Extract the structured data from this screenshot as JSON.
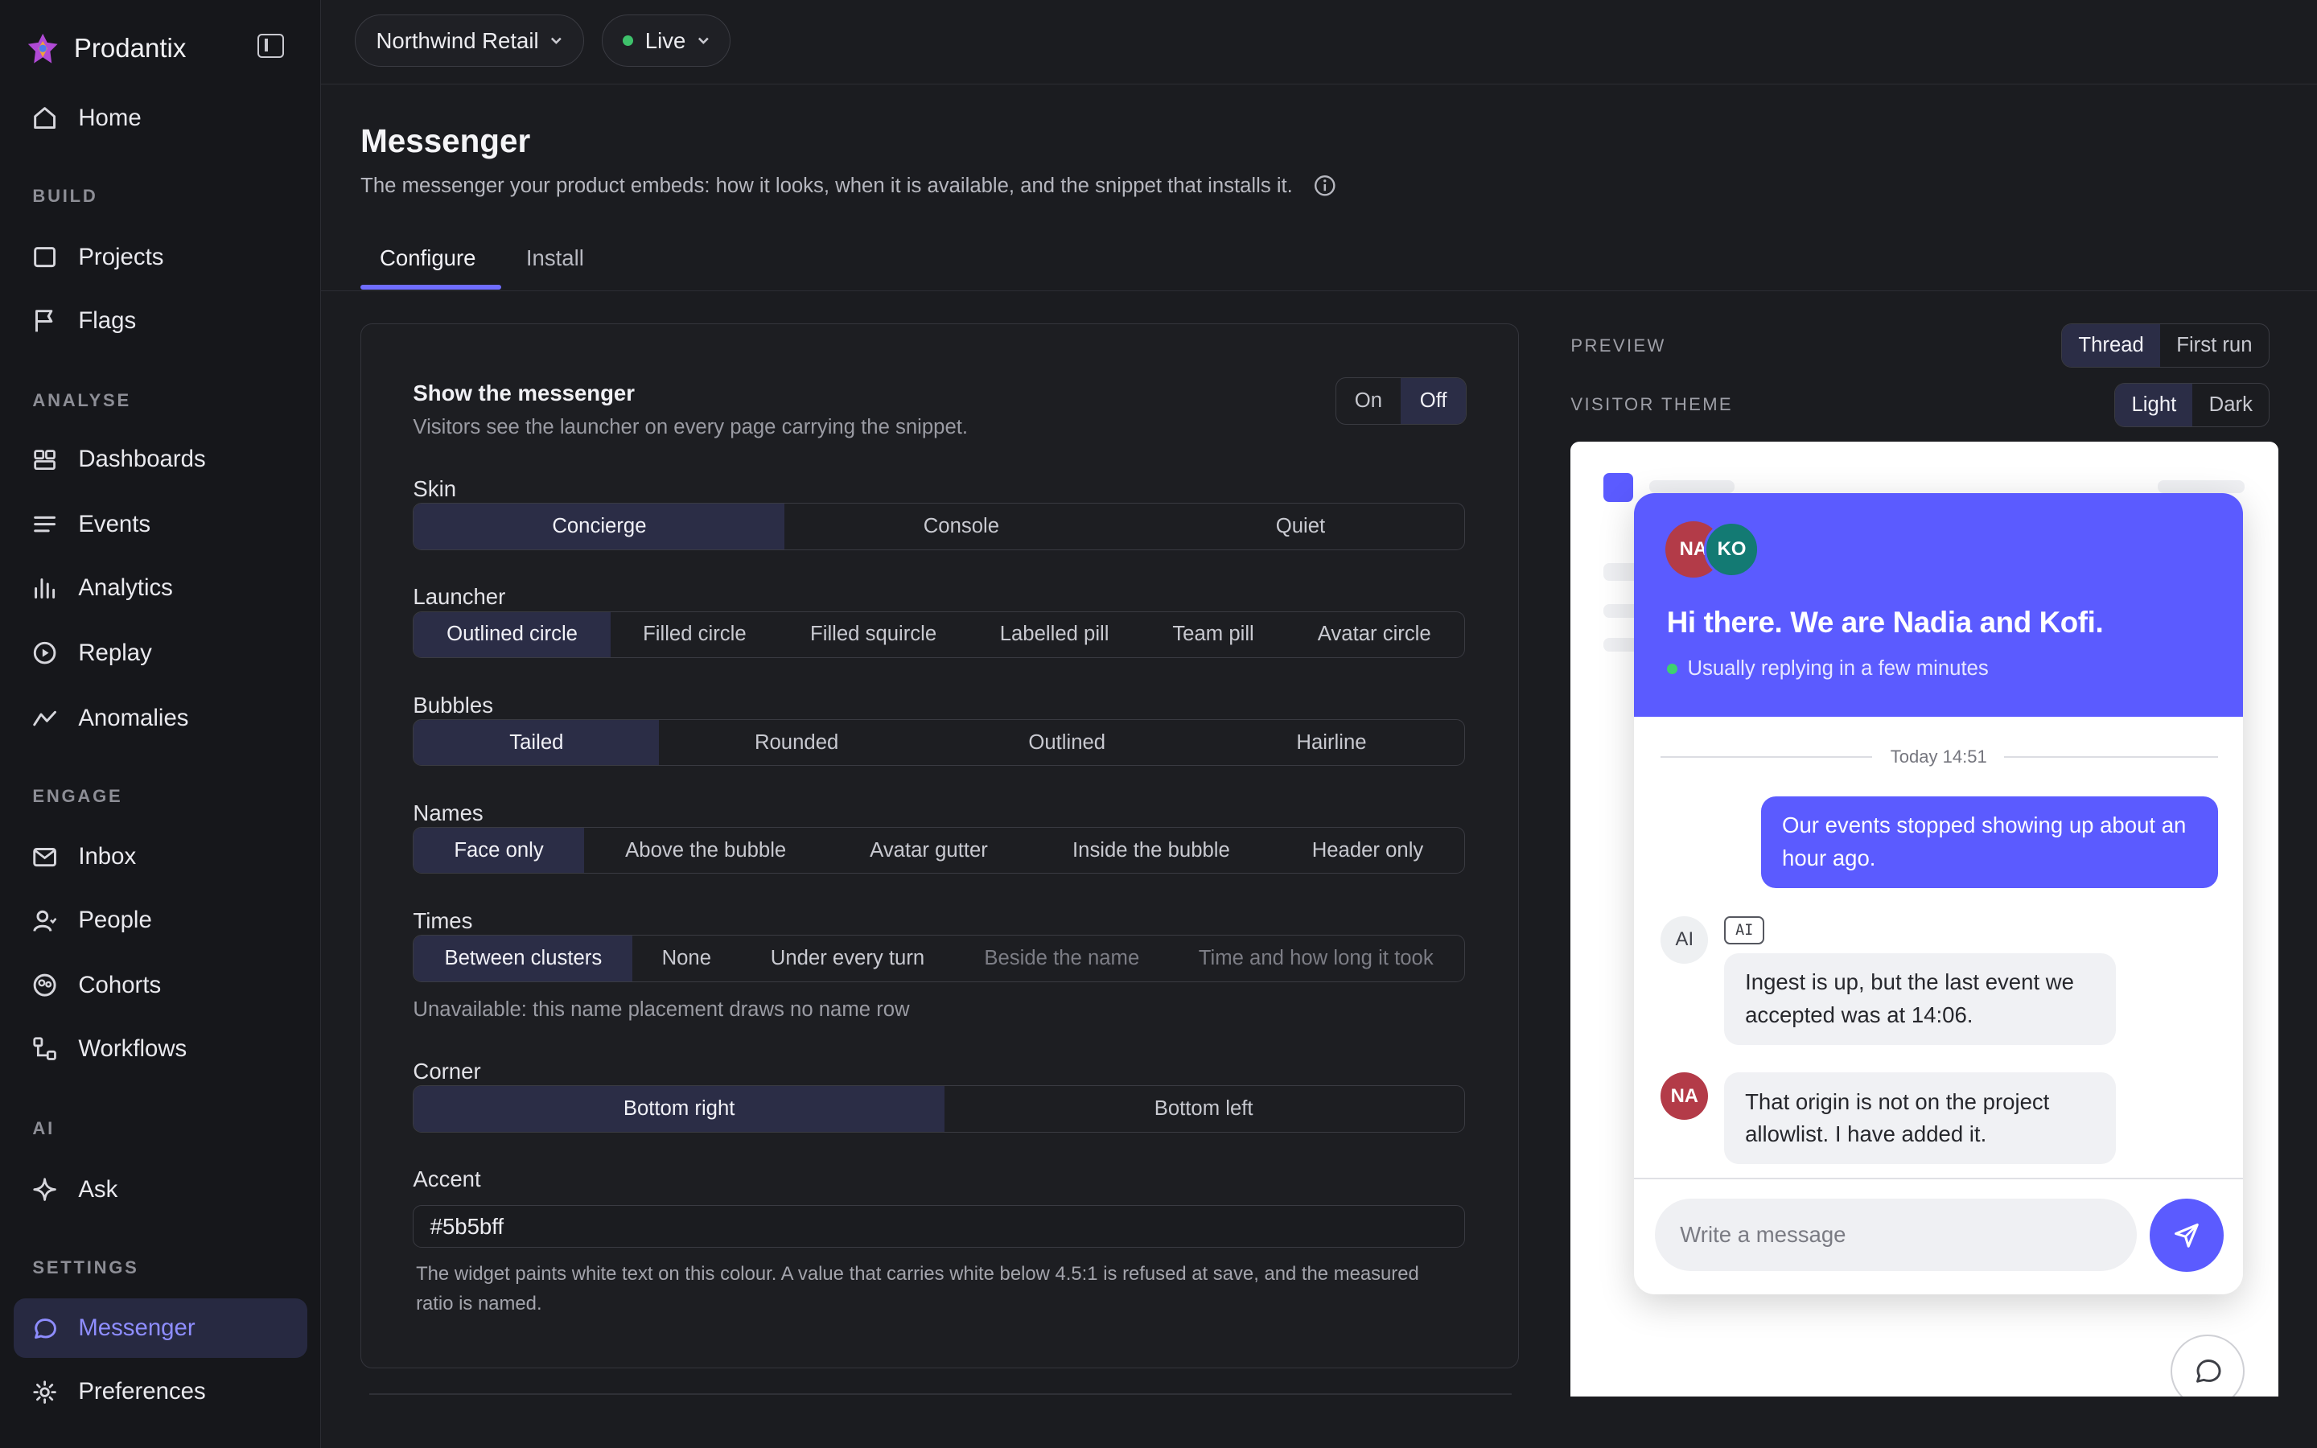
{
  "app": {
    "name": "Prodantix"
  },
  "sidebar": {
    "home": "Home",
    "sections": {
      "build": "BUILD",
      "analyse": "ANALYSE",
      "engage": "ENGAGE",
      "ai": "AI",
      "settings": "SETTINGS"
    },
    "items": {
      "projects": "Projects",
      "flags": "Flags",
      "dashboards": "Dashboards",
      "events": "Events",
      "analytics": "Analytics",
      "replay": "Replay",
      "anomalies": "Anomalies",
      "inbox": "Inbox",
      "people": "People",
      "cohorts": "Cohorts",
      "workflows": "Workflows",
      "ask": "Ask",
      "messenger": "Messenger",
      "preferences": "Preferences"
    },
    "active": "messenger"
  },
  "topbar": {
    "workspace": "Northwind Retail",
    "environment": "Live",
    "environment_status_color": "#3ec16b"
  },
  "page": {
    "title": "Messenger",
    "subtitle": "The messenger your product embeds: how it looks, when it is available, and the snippet that installs it.",
    "tabs": {
      "configure": "Configure",
      "install": "Install"
    },
    "active_tab": "Configure"
  },
  "config": {
    "show": {
      "label": "Show the messenger",
      "help": "Visitors see the launcher on every page carrying the snippet.",
      "on": "On",
      "off": "Off",
      "selected": "Off"
    },
    "skin": {
      "label": "Skin",
      "options": [
        "Concierge",
        "Console",
        "Quiet"
      ],
      "selected": "Concierge"
    },
    "launcher": {
      "label": "Launcher",
      "options": [
        "Outlined circle",
        "Filled circle",
        "Filled squircle",
        "Labelled pill",
        "Team pill",
        "Avatar circle"
      ],
      "selected": "Outlined circle"
    },
    "bubbles": {
      "label": "Bubbles",
      "options": [
        "Tailed",
        "Rounded",
        "Outlined",
        "Hairline"
      ],
      "selected": "Tailed"
    },
    "names": {
      "label": "Names",
      "options": [
        "Face only",
        "Above the bubble",
        "Avatar gutter",
        "Inside the bubble",
        "Header only"
      ],
      "selected": "Face only"
    },
    "times": {
      "label": "Times",
      "options": [
        "Between clusters",
        "None",
        "Under every turn",
        "Beside the name",
        "Time and how long it took"
      ],
      "selected": "Between clusters",
      "unavailable": [
        "Beside the name",
        "Time and how long it took"
      ],
      "note": "Unavailable: this name placement draws no name row"
    },
    "corner": {
      "label": "Corner",
      "options": [
        "Bottom right",
        "Bottom left"
      ],
      "selected": "Bottom right"
    },
    "accent": {
      "label": "Accent",
      "value": "#5b5bff",
      "help": "The widget paints white text on this colour. A value that carries white below 4.5:1 is refused at save, and the measured ratio is named."
    }
  },
  "preview": {
    "label": "PREVIEW",
    "modes": [
      "Thread",
      "First run"
    ],
    "mode_selected": "Thread",
    "theme_label": "VISITOR THEME",
    "themes": [
      "Light",
      "Dark"
    ],
    "theme_selected": "Light",
    "widget": {
      "avatars": [
        "NA",
        "KO"
      ],
      "avatar_colors": [
        "#b33b48",
        "#137a73"
      ],
      "title": "Hi there. We are Nadia and Kofi.",
      "status": "Usually replying in a few minutes",
      "timestamp": "Today 14:51",
      "messages": [
        {
          "from": "visitor",
          "text": "Our events stopped showing up about an hour ago."
        },
        {
          "from": "AI",
          "tag": "AI",
          "text": "Ingest is up, but the last event we accepted was at 14:06."
        },
        {
          "from": "NA",
          "text": "That origin is not on the project allowlist. I have added it."
        }
      ],
      "composer_placeholder": "Write a message"
    }
  }
}
